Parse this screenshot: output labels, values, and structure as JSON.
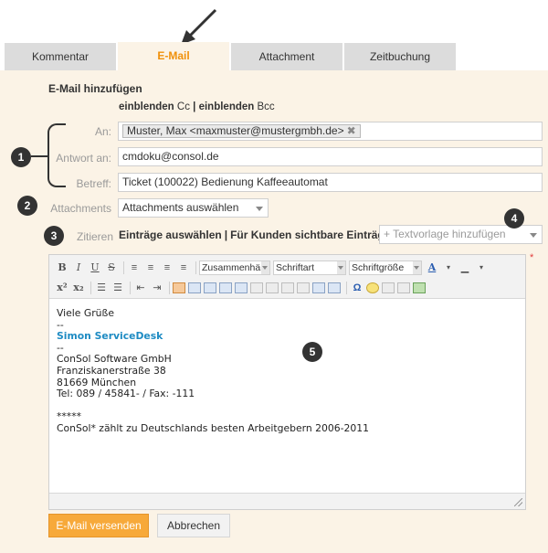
{
  "tabs": [
    {
      "label": "Kommentar",
      "active": false
    },
    {
      "label": "E-Mail",
      "active": true
    },
    {
      "label": "Attachment",
      "active": false
    },
    {
      "label": "Zeitbuchung",
      "active": false
    }
  ],
  "section_title": "E-Mail hinzufügen",
  "cc_bcc": {
    "show": "einblenden",
    "cc": "Cc",
    "separator": "|",
    "bcc": "Bcc"
  },
  "fields": {
    "to": {
      "label": "An:",
      "recipient": "Muster, Max <maxmuster@mustergmbh.de>",
      "remove": "✖"
    },
    "reply_to": {
      "label": "Antwort an:",
      "value": "cmdoku@consol.de"
    },
    "subject": {
      "label": "Betreff:",
      "value": "Ticket (100022) Bedienung Kaffeeautomat"
    },
    "attachments": {
      "label": "Attachments",
      "value": "Attachments auswählen"
    }
  },
  "quote": {
    "label": "Zitieren",
    "select_entries": "Einträge auswählen",
    "separator": "|",
    "customer_entries": "Für Kunden sichtbare Einträge",
    "template_placeholder": "+ Textvorlage hinzufügen"
  },
  "toolbar": {
    "bold": "B",
    "italic": "I",
    "underline": "U",
    "strike": "S",
    "superscript": "x²",
    "subscript": "x₂",
    "format": "Zusammenhängend",
    "font": "Schriftart",
    "size": "Schriftgröße",
    "text_color": "A"
  },
  "editor_content": {
    "greeting": "Viele Grüße",
    "dash1": "--",
    "signature_name": "Simon ServiceDesk",
    "dash2": "--",
    "company": "ConSol Software GmbH",
    "street": "Franziskanerstraße 38",
    "city": "81669 München",
    "phone": "Tel: 089 / 45841- / Fax: -111",
    "stars": "*****",
    "tagline": "ConSol* zählt zu Deutschlands besten Arbeitgebern 2006-2011"
  },
  "callouts": [
    "1",
    "2",
    "3",
    "4",
    "5"
  ],
  "required_mark": "*",
  "buttons": {
    "send": "E-Mail versenden",
    "cancel": "Abbrechen"
  },
  "colors": {
    "accent": "#f0900a",
    "panel": "#fbf3e6",
    "tab_inactive": "#dcdcdc",
    "send_button": "#f7a93a",
    "signature": "#1e8bc3"
  }
}
